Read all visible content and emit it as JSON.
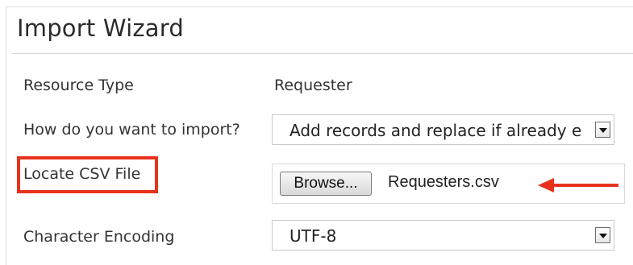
{
  "wizard": {
    "title": "Import Wizard",
    "resource_type": {
      "label": "Resource Type",
      "value": "Requester"
    },
    "import_mode": {
      "label": "How do you want to import?",
      "selected": "Add records and replace if already e"
    },
    "csv_file": {
      "label": "Locate CSV File",
      "browse_label": "Browse...",
      "file_name": "Requesters.csv"
    },
    "encoding": {
      "label": "Character Encoding",
      "selected": "UTF-8"
    }
  },
  "annotations": {
    "highlight_color": "#e8321e",
    "arrow_color": "#e8321e"
  },
  "icons": {
    "dropdown": "chevron-down-icon",
    "arrow": "arrow-left-icon"
  }
}
